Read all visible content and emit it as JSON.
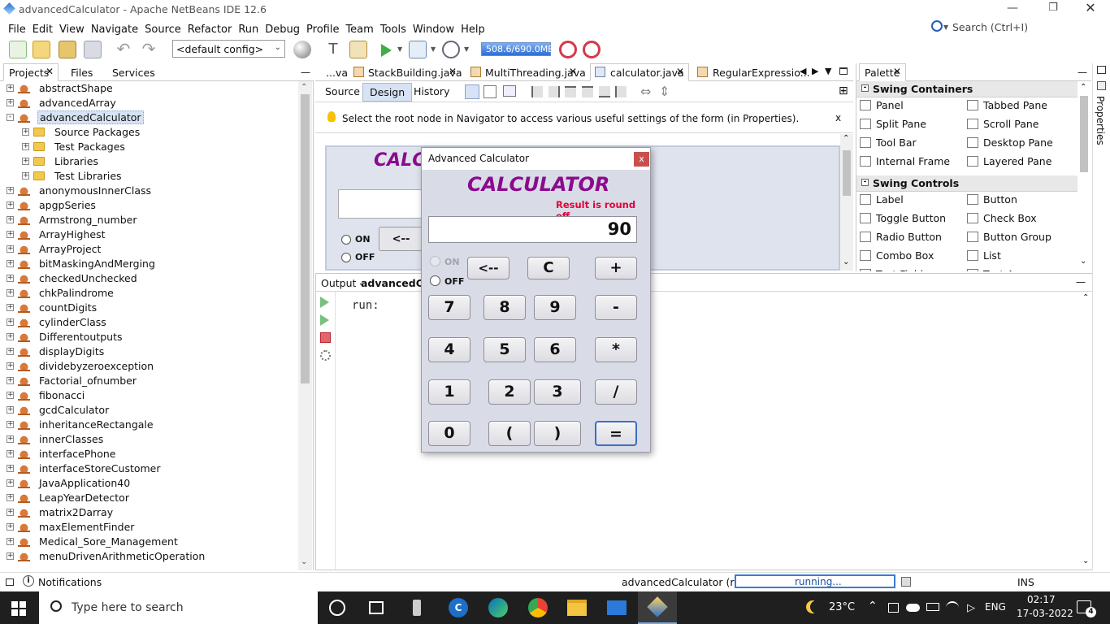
{
  "window": {
    "title": "advancedCalculator - Apache NetBeans IDE 12.6"
  },
  "menu": [
    "File",
    "Edit",
    "View",
    "Navigate",
    "Source",
    "Refactor",
    "Run",
    "Debug",
    "Profile",
    "Team",
    "Tools",
    "Window",
    "Help"
  ],
  "search": {
    "placeholder": "Search (Ctrl+I)"
  },
  "toolbar": {
    "config": "<default config>",
    "memory": "508.6/690.0MB"
  },
  "left_tabs": [
    "Projects",
    "Files",
    "Services"
  ],
  "projects": [
    {
      "label": "abstractShape",
      "level": 0,
      "kind": "project",
      "exp": "+"
    },
    {
      "label": "advancedArray",
      "level": 0,
      "kind": "project",
      "exp": "+"
    },
    {
      "label": "advancedCalculator",
      "level": 0,
      "kind": "project",
      "exp": "-",
      "selected": true
    },
    {
      "label": "Source Packages",
      "level": 1,
      "kind": "folder",
      "exp": "+"
    },
    {
      "label": "Test Packages",
      "level": 1,
      "kind": "folder",
      "exp": "+"
    },
    {
      "label": "Libraries",
      "level": 1,
      "kind": "folder",
      "exp": "+"
    },
    {
      "label": "Test Libraries",
      "level": 1,
      "kind": "folder",
      "exp": "+"
    },
    {
      "label": "anonymousInnerClass",
      "level": 0,
      "kind": "project",
      "exp": "+"
    },
    {
      "label": "apgpSeries",
      "level": 0,
      "kind": "project",
      "exp": "+"
    },
    {
      "label": "Armstrong_number",
      "level": 0,
      "kind": "project",
      "exp": "+"
    },
    {
      "label": "ArrayHighest",
      "level": 0,
      "kind": "project",
      "exp": "+"
    },
    {
      "label": "ArrayProject",
      "level": 0,
      "kind": "project",
      "exp": "+"
    },
    {
      "label": "bitMaskingAndMerging",
      "level": 0,
      "kind": "project",
      "exp": "+"
    },
    {
      "label": "checkedUnchecked",
      "level": 0,
      "kind": "project",
      "exp": "+"
    },
    {
      "label": "chkPalindrome",
      "level": 0,
      "kind": "project",
      "exp": "+"
    },
    {
      "label": "countDigits",
      "level": 0,
      "kind": "project",
      "exp": "+"
    },
    {
      "label": "cylinderClass",
      "level": 0,
      "kind": "project",
      "exp": "+"
    },
    {
      "label": "Differentoutputs",
      "level": 0,
      "kind": "project",
      "exp": "+"
    },
    {
      "label": "displayDigits",
      "level": 0,
      "kind": "project",
      "exp": "+"
    },
    {
      "label": "dividebyzeroexception",
      "level": 0,
      "kind": "project",
      "exp": "+"
    },
    {
      "label": "Factorial_ofnumber",
      "level": 0,
      "kind": "project",
      "exp": "+"
    },
    {
      "label": "fibonacci",
      "level": 0,
      "kind": "project",
      "exp": "+"
    },
    {
      "label": "gcdCalculator",
      "level": 0,
      "kind": "project",
      "exp": "+"
    },
    {
      "label": "inheritanceRectangale",
      "level": 0,
      "kind": "project",
      "exp": "+"
    },
    {
      "label": "innerClasses",
      "level": 0,
      "kind": "project",
      "exp": "+"
    },
    {
      "label": "interfacePhone",
      "level": 0,
      "kind": "project",
      "exp": "+"
    },
    {
      "label": "interfaceStoreCustomer",
      "level": 0,
      "kind": "project",
      "exp": "+"
    },
    {
      "label": "JavaApplication40",
      "level": 0,
      "kind": "project",
      "exp": "+"
    },
    {
      "label": "LeapYearDetector",
      "level": 0,
      "kind": "project",
      "exp": "+"
    },
    {
      "label": "matrix2Darray",
      "level": 0,
      "kind": "project",
      "exp": "+"
    },
    {
      "label": "maxElementFinder",
      "level": 0,
      "kind": "project",
      "exp": "+"
    },
    {
      "label": "Medical_Sore_Management",
      "level": 0,
      "kind": "project",
      "exp": "+"
    },
    {
      "label": "menuDrivenArithmeticOperation",
      "level": 0,
      "kind": "project",
      "exp": "+"
    }
  ],
  "editor_tabs": [
    "...va",
    "StackBuilding.java",
    "MultiThreading.java",
    "calculator.java",
    "RegularExpressio..."
  ],
  "design_tabs": {
    "source": "Source",
    "design": "Design",
    "history": "History"
  },
  "hint": "Select the root node in Navigator to access various useful settings of the form (in Properties).",
  "hint_close": "x",
  "form_preview": {
    "title": "CALC",
    "on": "ON",
    "off": "OFF",
    "back": "<--"
  },
  "output": {
    "title": "Output - ",
    "project": "advancedCalc",
    "text": "run:"
  },
  "palette": {
    "title": "Palette",
    "sections": [
      {
        "name": "Swing Containers",
        "items": [
          "Panel",
          "Tabbed Pane",
          "Split Pane",
          "Scroll Pane",
          "Tool Bar",
          "Desktop Pane",
          "Internal Frame",
          "Layered Pane"
        ]
      },
      {
        "name": "Swing Controls",
        "items": [
          "Label",
          "Button",
          "Toggle Button",
          "Check Box",
          "Radio Button",
          "Button Group",
          "Combo Box",
          "List",
          "Text Field",
          "Text Area"
        ]
      }
    ],
    "properties_label": "Properties"
  },
  "calculator": {
    "window_title": "Advanced Calculator",
    "close": "x",
    "heading": "CALCULATOR",
    "note": "Result is round off",
    "display": "90",
    "on": "ON",
    "off": "OFF",
    "keys": [
      "<--",
      "C",
      "+",
      "7",
      "8",
      "9",
      "-",
      "4",
      "5",
      "6",
      "*",
      "1",
      "2",
      "3",
      "/",
      "0",
      "(",
      ")",
      "="
    ]
  },
  "status": {
    "notifications": "Notifications",
    "run_label": "advancedCalculator (run)",
    "progress": "running...",
    "mode": "INS"
  },
  "taskbar": {
    "search_placeholder": "Type here to search",
    "temp": "23°C",
    "lang": "ENG",
    "time": "02:17",
    "date": "17-03-2022",
    "notif_count": "4"
  },
  "colors": {
    "accent_purple": "#8b0a8f",
    "note_red": "#e4003a",
    "selection": "#d7e3f4",
    "taskbar": "#1f1f1f"
  }
}
